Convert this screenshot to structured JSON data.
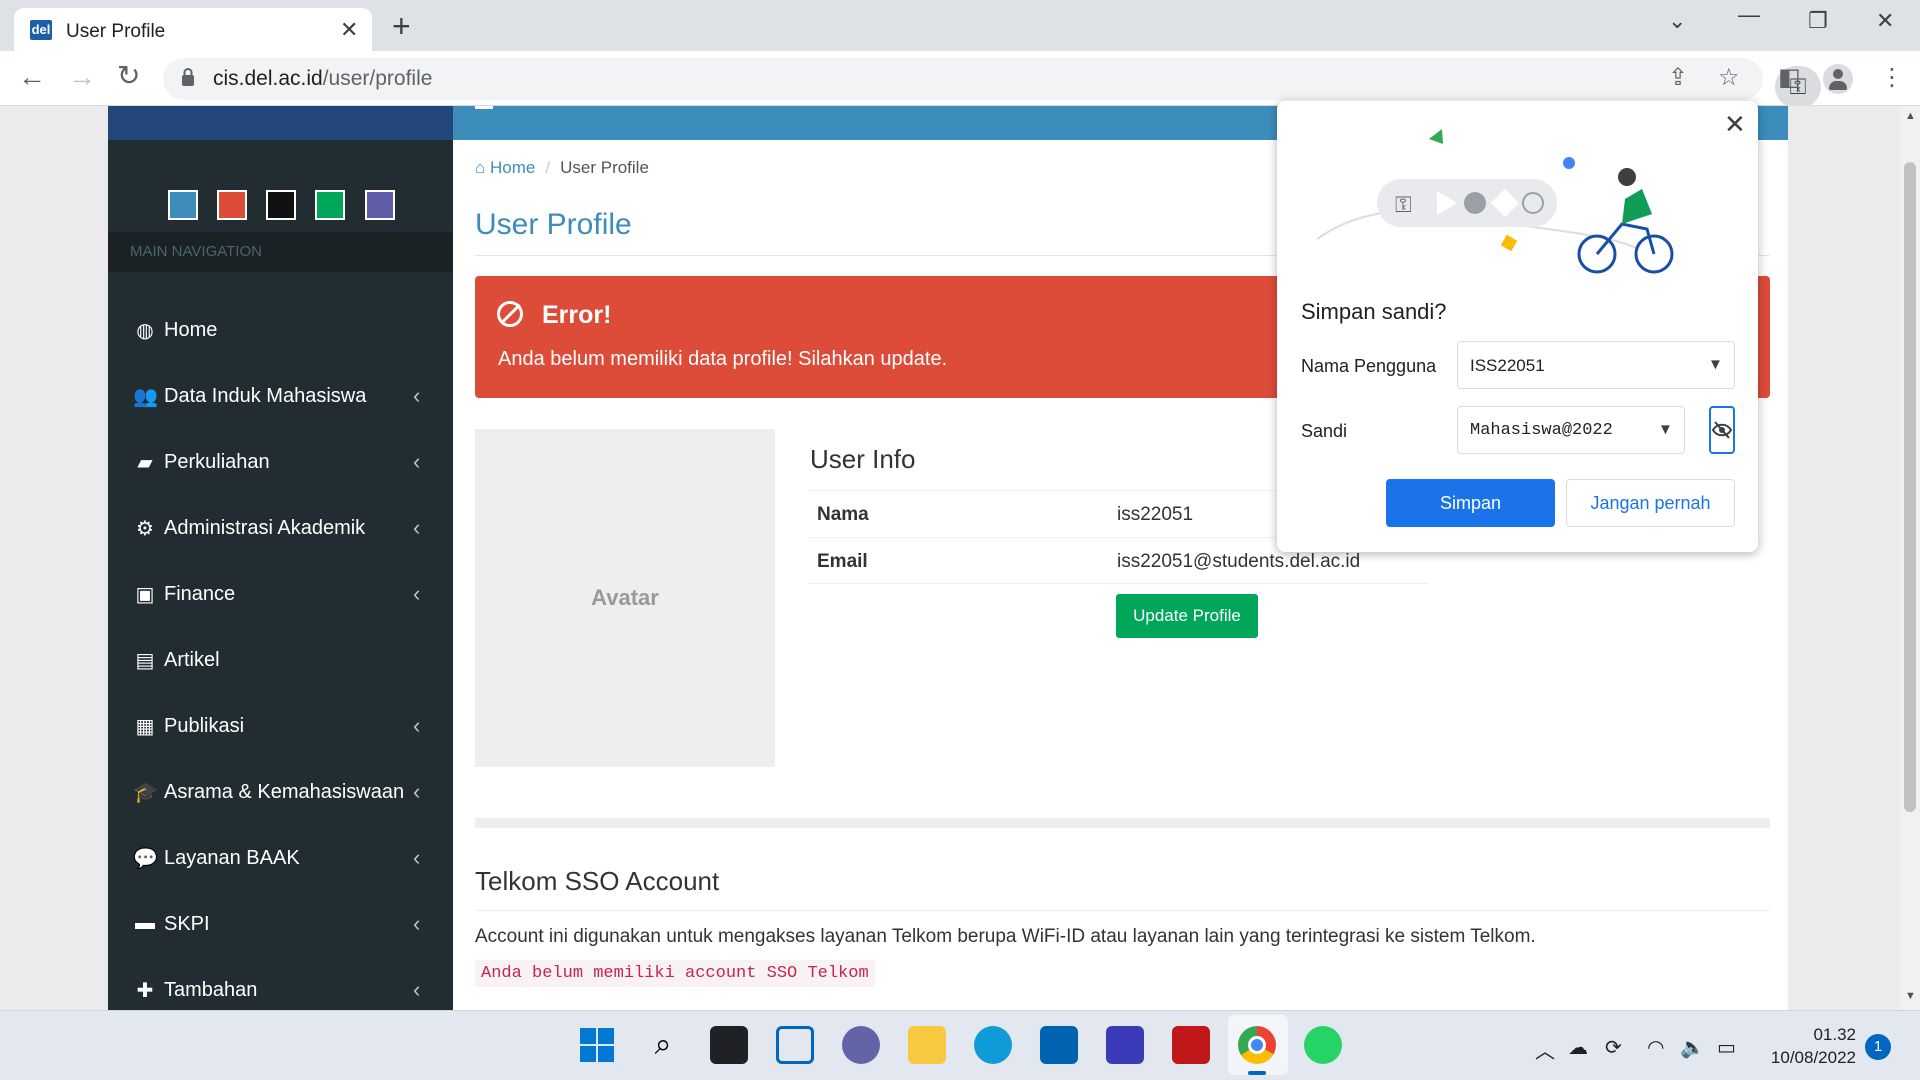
{
  "browser": {
    "tab_title": "User Profile",
    "tab_favicon_text": "del",
    "url_host": "cis.del.ac.id",
    "url_path": "/user/profile"
  },
  "theme": {
    "swatches": [
      "#3c8dbc",
      "#dd4b39",
      "#111111",
      "#00a65a",
      "#605ca8"
    ],
    "error": "#dd4b39",
    "success": "#00a65a",
    "primary": "#3c8dbc",
    "chrome_blue": "#1a73e8"
  },
  "sidebar": {
    "header": "MAIN NAVIGATION",
    "items": [
      {
        "label": "Home",
        "icon": "dashboard-icon",
        "glyph": "◍",
        "has_children": false
      },
      {
        "label": "Data Induk Mahasiswa",
        "icon": "users-icon",
        "glyph": "👥",
        "has_children": true
      },
      {
        "label": "Perkuliahan",
        "icon": "book-icon",
        "glyph": "▰",
        "has_children": true
      },
      {
        "label": "Administrasi Akademik",
        "icon": "gears-icon",
        "glyph": "⚙",
        "has_children": true
      },
      {
        "label": "Finance",
        "icon": "money-icon",
        "glyph": "▣",
        "has_children": true
      },
      {
        "label": "Artikel",
        "icon": "file-icon",
        "glyph": "▤",
        "has_children": false
      },
      {
        "label": "Publikasi",
        "icon": "newspaper-icon",
        "glyph": "▦",
        "has_children": true
      },
      {
        "label": "Asrama & Kemahasiswaan",
        "icon": "graduation-cap-icon",
        "glyph": "🎓",
        "has_children": true
      },
      {
        "label": "Layanan BAAK",
        "icon": "comments-icon",
        "glyph": "💬",
        "has_children": true
      },
      {
        "label": "SKPI",
        "icon": "archive-icon",
        "glyph": "▬",
        "has_children": true
      },
      {
        "label": "Tambahan",
        "icon": "plus-square-icon",
        "glyph": "✚",
        "has_children": true
      }
    ],
    "chevron": "‹"
  },
  "breadcrumb": {
    "home": "Home",
    "current": "User Profile"
  },
  "page": {
    "title": "User Profile",
    "alert": {
      "title": "Error!",
      "message": "Anda belum memiliki data profile! Silahkan update."
    },
    "avatar_label": "Avatar",
    "user_info": {
      "title": "User Info",
      "rows": [
        {
          "key": "Nama",
          "value": "iss22051"
        },
        {
          "key": "Email",
          "value": "iss22051@students.del.ac.id"
        }
      ],
      "update_button": "Update Profile"
    },
    "sso": {
      "title": "Telkom SSO Account",
      "description": "Account ini digunakan untuk mengakses layanan Telkom berupa WiFi-ID atau layanan lain yang terintegrasi ke sistem Telkom.",
      "notice": "Anda belum memiliki account SSO Telkom"
    }
  },
  "password_bubble": {
    "title": "Simpan sandi?",
    "username_label": "Nama Pengguna",
    "username_value": "ISS22051",
    "password_label": "Sandi",
    "password_value": "Mahasiswa@2022",
    "save_button": "Simpan",
    "never_button": "Jangan pernah"
  },
  "taskbar": {
    "time": "01.32",
    "date": "10/08/2022",
    "notification_count": "1"
  }
}
